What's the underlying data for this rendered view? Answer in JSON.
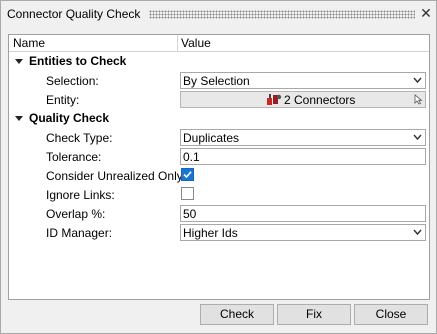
{
  "window": {
    "title": "Connector Quality Check",
    "close_glyph": "✕"
  },
  "grid": {
    "headers": {
      "name": "Name",
      "value": "Value"
    },
    "groups": [
      {
        "label": "Entities to Check",
        "rows": [
          {
            "label": "Selection:",
            "type": "dropdown",
            "value": "By Selection"
          },
          {
            "label": "Entity:",
            "type": "entity",
            "value": "2 Connectors",
            "icon": "connector-icon"
          }
        ]
      },
      {
        "label": "Quality Check",
        "rows": [
          {
            "label": "Check Type:",
            "type": "dropdown",
            "value": "Duplicates"
          },
          {
            "label": "Tolerance:",
            "type": "text",
            "value": "0.1"
          },
          {
            "label": "Consider Unrealized Only:",
            "type": "checkbox",
            "checked": true
          },
          {
            "label": "Ignore Links:",
            "type": "checkbox",
            "checked": false
          },
          {
            "label": "Overlap %:",
            "type": "text",
            "value": "50"
          },
          {
            "label": "ID Manager:",
            "type": "dropdown",
            "value": "Higher Ids"
          }
        ]
      }
    ]
  },
  "buttons": {
    "check": "Check",
    "fix": "Fix",
    "close": "Close"
  },
  "colors": {
    "checkbox_checked": "#1976d2",
    "dialog_bg": "#f0f0f0"
  }
}
